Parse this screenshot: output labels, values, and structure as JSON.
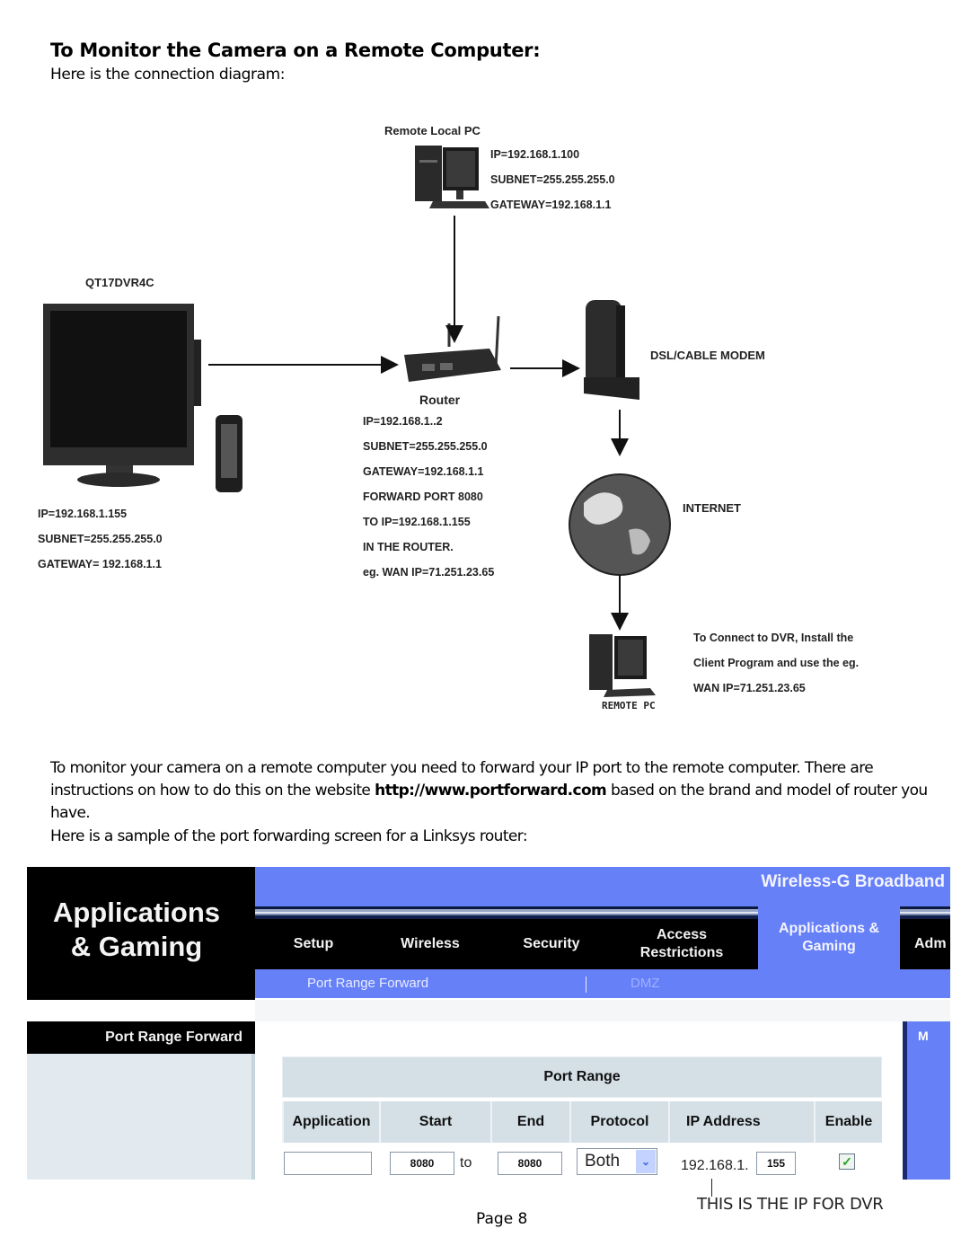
{
  "heading": "To Monitor the Camera on a Remote Computer:",
  "intro": "Here is the connection diagram:",
  "diagram": {
    "remote_local_pc": {
      "label": "Remote Local PC",
      "lines": [
        "IP=192.168.1.100",
        "SUBNET=255.255.255.0",
        "GATEWAY=192.168.1.1"
      ]
    },
    "dvr": {
      "label": "QT17DVR4C",
      "lines": [
        "IP=192.168.1.155",
        "SUBNET=255.255.255.0",
        "GATEWAY= 192.168.1.1"
      ]
    },
    "router": {
      "label": "Router",
      "lines": [
        "IP=192.168.1..2",
        "SUBNET=255.255.255.0",
        "GATEWAY=192.168.1.1",
        "FORWARD PORT 8080",
        "TO IP=192.168.1.155",
        "IN THE ROUTER.",
        "eg. WAN IP=71.251.23.65"
      ]
    },
    "modem": {
      "label": "DSL/CABLE MODEM"
    },
    "internet": {
      "label": "INTERNET"
    },
    "remote_pc": {
      "label": "REMOTE PC",
      "lines": [
        "To Connect to DVR, Install the",
        "Client Program and use the eg.",
        "WAN IP=71.251.23.65"
      ]
    }
  },
  "body": {
    "p1_before": "To monitor your camera on a remote computer you need to forward your IP port to the remote computer. There are instructions on how to do this on the website ",
    "p1_link": "http://www.portforward.com",
    "p1_after": " based on the brand and model of router you have.",
    "p2": "Here is a sample of the port forwarding screen for a Linksys router:"
  },
  "linksys": {
    "section_title_line1": "Applications",
    "section_title_line2": "& Gaming",
    "product": "Wireless-G Broadband",
    "tabs": [
      {
        "label": "Setup"
      },
      {
        "label": "Wireless"
      },
      {
        "label": "Security"
      },
      {
        "label": "Access Restrictions"
      },
      {
        "label": "Applications & Gaming",
        "active": true
      },
      {
        "label": "Adm"
      }
    ],
    "subtabs": [
      {
        "label": "Port Range Forward",
        "active": true
      },
      {
        "label": "DMZ"
      }
    ],
    "left_section": "Port Range Forward",
    "right_panel_letter": "M",
    "table": {
      "group_header": "Port Range",
      "columns": [
        "Application",
        "Start",
        "End",
        "Protocol",
        "IP Address",
        "Enable"
      ],
      "row": {
        "application": "",
        "start": "8080",
        "to_label": "to",
        "end": "8080",
        "protocol": "Both",
        "ip_prefix": "192.168.1.",
        "ip_last": "155",
        "enabled": true
      }
    },
    "callout": "THIS IS THE IP FOR DVR"
  },
  "footer": {
    "page": "Page 8"
  }
}
